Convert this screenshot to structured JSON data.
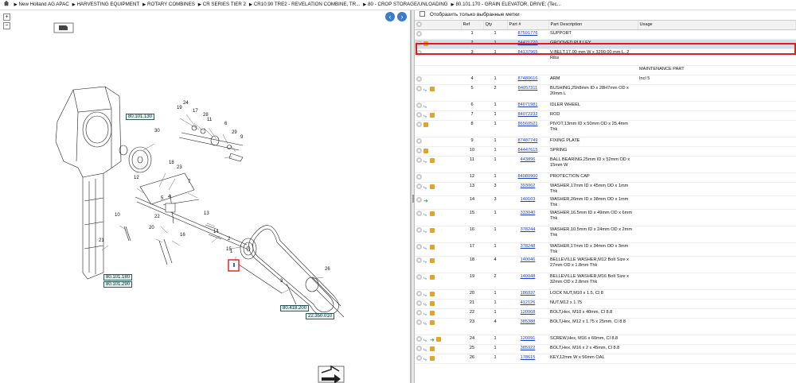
{
  "breadcrumb": {
    "items": [
      "New Holland AG APAC",
      "HARVESTING EQUIPMENT",
      "ROTARY COMBINES",
      "CR SERIES TIER 2",
      "CR10.90 TRE2 - REVELATION COMBINE, TR...",
      "80 - CROP STORAGE/UNLOADING",
      "80.101.170 - GRAIN ELEVATOR, DRIVE; (Tec..."
    ]
  },
  "diagram": {
    "zoom_in": "+",
    "zoom_out": "−",
    "references": [
      "80.101.130",
      "80.101.180",
      "80.101.290",
      "80.418.200",
      "22.350.010"
    ],
    "callouts": [
      "24",
      "19",
      "17",
      "28",
      "11",
      "6",
      "29",
      "30",
      "9",
      "18",
      "23",
      "12",
      "3",
      "7",
      "4",
      "5",
      "13",
      "10",
      "22",
      "20",
      "16",
      "14",
      "2",
      "15",
      "1",
      "26",
      "21"
    ]
  },
  "parts": {
    "filter_label": "Отобразить только выбранные метки",
    "columns": [
      "Ref",
      "Qty",
      "Part #",
      "Part Description",
      "Usage"
    ],
    "rows": [
      {
        "ref": "1",
        "qty": "1",
        "part": "87591776",
        "desc": "SUPPORT",
        "usage": "",
        "icons": [
          "add"
        ]
      },
      {
        "ref": "2",
        "qty": "1",
        "part": "84421720",
        "desc": "GROOVED PULLEY",
        "usage": "",
        "icons": [
          "add",
          "box"
        ],
        "selected": true
      },
      {
        "ref": "3",
        "qty": "1",
        "part": "84137965",
        "desc": "V-BELT,17.00 mm W x 3290.00 mm L, 2 Ribs",
        "usage": "",
        "icons": [
          "add"
        ]
      },
      {
        "ref": "",
        "qty": "",
        "part": "",
        "desc": "",
        "usage": "MAINTENANCE PART",
        "icons": []
      },
      {
        "ref": "4",
        "qty": "1",
        "part": "87480616",
        "desc": "ARM",
        "usage": "Incl 5",
        "icons": [
          "add"
        ]
      },
      {
        "ref": "5",
        "qty": "2",
        "part": "84057311",
        "desc": "BUSHING,25h8mm ID x 28H7mm OD x 20mm L",
        "usage": "",
        "icons": [
          "add",
          "link",
          "box"
        ]
      },
      {
        "ref": "6",
        "qty": "1",
        "part": "84071981",
        "desc": "IDLER WHEEL",
        "usage": "",
        "icons": [
          "add",
          "link"
        ]
      },
      {
        "ref": "7",
        "qty": "1",
        "part": "84072232",
        "desc": "ROD",
        "usage": "",
        "icons": [
          "add",
          "link",
          "box"
        ]
      },
      {
        "ref": "8",
        "qty": "1",
        "part": "86560521",
        "desc": "PIVOT,13mm ID x 50mm OD x 25.4mm Thk",
        "usage": "",
        "icons": [
          "add",
          "box"
        ]
      },
      {
        "ref": "9",
        "qty": "1",
        "part": "87487749",
        "desc": "FIXING PLATE",
        "usage": "",
        "icons": [
          "add"
        ]
      },
      {
        "ref": "10",
        "qty": "1",
        "part": "84447615",
        "desc": "SPRING",
        "usage": "",
        "icons": [
          "add",
          "box"
        ]
      },
      {
        "ref": "11",
        "qty": "1",
        "part": "443896",
        "desc": "BALL BEARING,25mm ID x 52mm OD x 15mm W",
        "usage": "",
        "icons": [
          "add",
          "link",
          "box"
        ]
      },
      {
        "ref": "12",
        "qty": "1",
        "part": "84980900",
        "desc": "PROTECTION CAP",
        "usage": "",
        "icons": [
          "add"
        ]
      },
      {
        "ref": "13",
        "qty": "3",
        "part": "393062",
        "desc": "WASHER,17mm ID x 45mm OD x 1mm Thk",
        "usage": "",
        "icons": [
          "add",
          "link",
          "box"
        ]
      },
      {
        "ref": "14",
        "qty": "3",
        "part": "140103",
        "desc": "WASHER,26mm ID x 38mm OD x 1mm Thk",
        "usage": "",
        "icons": [
          "add",
          "green"
        ]
      },
      {
        "ref": "15",
        "qty": "1",
        "part": "333040",
        "desc": "WASHER,16.5mm ID x 49mm OD x 6mm Thk",
        "usage": "",
        "icons": [
          "add",
          "link",
          "box"
        ]
      },
      {
        "ref": "16",
        "qty": "1",
        "part": "378244",
        "desc": "WASHER,10.5mm ID x 24mm OD x 2mm Thk",
        "usage": "",
        "icons": [
          "add",
          "link",
          "box"
        ]
      },
      {
        "ref": "17",
        "qty": "1",
        "part": "378248",
        "desc": "WASHER,17mm ID x 34mm OD x 3mm Thk",
        "usage": "",
        "icons": [
          "add",
          "link",
          "box"
        ]
      },
      {
        "ref": "18",
        "qty": "4",
        "part": "140046",
        "desc": "BELLEVILLE WASHER,M12 Bolt Size x 27mm OD x 1.8mm Thk",
        "usage": "",
        "icons": [
          "add",
          "link",
          "box"
        ]
      },
      {
        "ref": "19",
        "qty": "2",
        "part": "140048",
        "desc": "BELLEVILLE WASHER,M16 Bolt Size x 32mm OD x 2.8mm Thk",
        "usage": "",
        "icons": [
          "add",
          "link",
          "box"
        ]
      },
      {
        "ref": "20",
        "qty": "1",
        "part": "186037",
        "desc": "LOCK NUT,M10 x 1.5, Cl 8",
        "usage": "",
        "icons": [
          "add",
          "link",
          "box"
        ]
      },
      {
        "ref": "21",
        "qty": "1",
        "part": "412126",
        "desc": "NUT,M12 x 1.75",
        "usage": "",
        "icons": [
          "add",
          "link",
          "box"
        ]
      },
      {
        "ref": "22",
        "qty": "1",
        "part": "120068",
        "desc": "BOLT,Hex, M10 x 40mm, Cl 8.8",
        "usage": "",
        "icons": [
          "add",
          "link",
          "box"
        ]
      },
      {
        "ref": "23",
        "qty": "4",
        "part": "385388",
        "desc": "BOLT,Hex, M12 x 1.75 x 25mm, Cl 8.8",
        "usage": "",
        "icons": [
          "add",
          "link",
          "box"
        ]
      },
      {
        "ref": "24",
        "qty": "1",
        "part": "120091",
        "desc": "SCREW,Hex, M16 x 60mm, Cl 8.8",
        "usage": "",
        "icons": [
          "add",
          "link",
          "green",
          "box"
        ]
      },
      {
        "ref": "25",
        "qty": "1",
        "part": "385922",
        "desc": "BOLT,Hex, M16 x 2 x 45mm, Cl 8.8",
        "usage": "",
        "icons": [
          "add",
          "link",
          "box"
        ]
      },
      {
        "ref": "26",
        "qty": "1",
        "part": "178615",
        "desc": "KEY,12mm W x 56mm OAL",
        "usage": "",
        "icons": [
          "add",
          "link",
          "box"
        ]
      }
    ]
  },
  "colors": {
    "accent": "#e21b1b",
    "link": "#1a3fbf",
    "selected_row": "#d8dce6",
    "ref_box": "#e3f3ee"
  }
}
